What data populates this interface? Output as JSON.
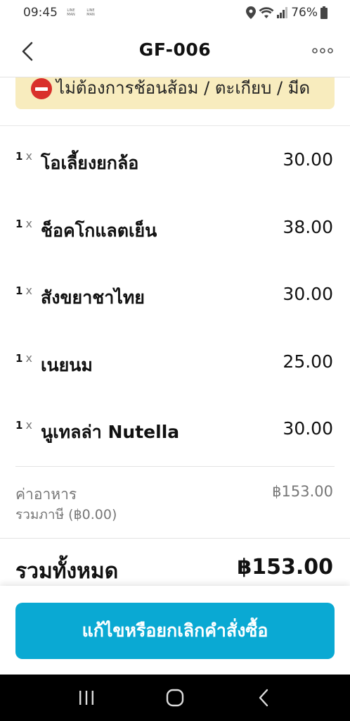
{
  "status_bar": {
    "time": "09:45",
    "battery": "76%",
    "badges": [
      "LINE MAN",
      "LINE MAN"
    ]
  },
  "header": {
    "title": "GF-006"
  },
  "note": {
    "text": "ไม่ต้องการช้อนส้อม / ตะเกียบ / มีด",
    "icon": "no-entry-icon"
  },
  "items": [
    {
      "qty": "1",
      "x": "x",
      "name": "โอเลี้ยงยกล้อ",
      "price": "30.00"
    },
    {
      "qty": "1",
      "x": "x",
      "name": "ช็อคโกแลตเย็น",
      "price": "38.00"
    },
    {
      "qty": "1",
      "x": "x",
      "name": "สังขยาชาไทย",
      "price": "30.00"
    },
    {
      "qty": "1",
      "x": "x",
      "name": "เนยนม",
      "price": "25.00"
    },
    {
      "qty": "1",
      "x": "x",
      "name": "นูเทลล่า Nutella",
      "price": "30.00"
    }
  ],
  "summary": {
    "subtotal_label": "ค่าอาหาร",
    "subtotal_value": "฿153.00",
    "tax_label": "รวมภาษี (฿0.00)",
    "total_label": "รวมทั้งหมด",
    "total_value": "฿153.00"
  },
  "action": {
    "button_label": "แก้ไขหรือยกเลิกคำสั่งซื้อ"
  },
  "colors": {
    "accent": "#0aa9d3",
    "note_bg": "#f8ecbe",
    "no_entry": "#d9302b"
  }
}
